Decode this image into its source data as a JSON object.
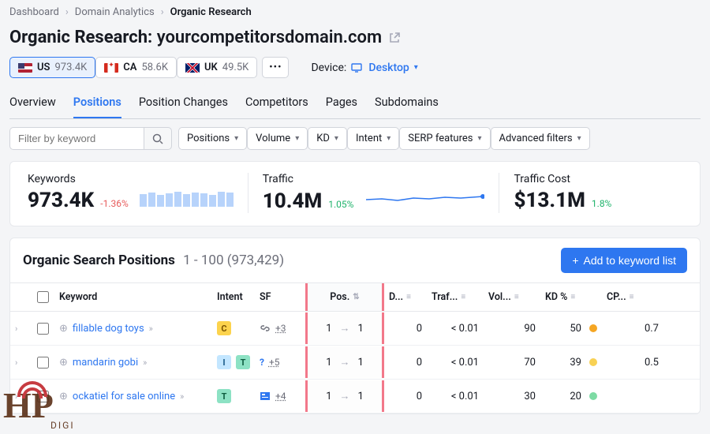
{
  "breadcrumb": {
    "a": "Dashboard",
    "b": "Domain Analytics",
    "c": "Organic Research"
  },
  "title": {
    "prefix": "Organic Research:",
    "domain": "yourcompetitorsdomain.com"
  },
  "countries": [
    {
      "code": "US",
      "val": "973.4K",
      "flag": "flag-us",
      "active": true
    },
    {
      "code": "CA",
      "val": "58.6K",
      "flag": "flag-ca",
      "active": false
    },
    {
      "code": "UK",
      "val": "49.5K",
      "flag": "flag-uk",
      "active": false
    }
  ],
  "device": {
    "label": "Device:",
    "value": "Desktop"
  },
  "tabs": [
    "Overview",
    "Positions",
    "Position Changes",
    "Competitors",
    "Pages",
    "Subdomains"
  ],
  "active_tab": "Positions",
  "filters": {
    "search_placeholder": "Filter by keyword",
    "buttons": [
      "Positions",
      "Volume",
      "KD",
      "Intent",
      "SERP features",
      "Advanced filters"
    ]
  },
  "metrics": {
    "keywords": {
      "label": "Keywords",
      "value": "973.4K",
      "delta": "-1.36%",
      "dir": "down",
      "bars": [
        16,
        18,
        15,
        17,
        19,
        16,
        18,
        17,
        15,
        19,
        18
      ]
    },
    "traffic": {
      "label": "Traffic",
      "value": "10.4M",
      "delta": "1.05%",
      "dir": "up"
    },
    "cost": {
      "label": "Traffic Cost",
      "value": "$13.1M",
      "delta": "1.8%",
      "dir": "up"
    }
  },
  "table": {
    "title": "Organic Search Positions",
    "range": "1 - 100 (973,429)",
    "add_btn": "Add to keyword list",
    "columns": {
      "keyword": "Keyword",
      "intent": "Intent",
      "sf": "SF",
      "pos": "Pos.",
      "d": "D...",
      "traf": "Traf...",
      "vol": "Vol...",
      "kd": "KD %",
      "cp": "CP..."
    },
    "rows": [
      {
        "kw": "fillable dog toys",
        "intent": [
          "C"
        ],
        "sf_icon": "link",
        "sf_count": "+3",
        "pos_from": 1,
        "pos_to": 1,
        "d": 0,
        "traf": "< 0.01",
        "vol": 90,
        "kd": 50,
        "kd_color": "or",
        "cp": "0.7"
      },
      {
        "kw": "mandarin gobi",
        "intent": [
          "I",
          "T"
        ],
        "sf_icon": "question",
        "sf_count": "+5",
        "pos_from": 1,
        "pos_to": 1,
        "d": 0,
        "traf": "< 0.01",
        "vol": 70,
        "kd": 39,
        "kd_color": "ye",
        "cp": "0.5"
      },
      {
        "kw": "ockatiel for sale online",
        "intent": [
          "T"
        ],
        "sf_icon": "card",
        "sf_count": "+4",
        "pos_from": 1,
        "pos_to": 1,
        "d": 0,
        "traf": "< 0.01",
        "vol": 30,
        "kd": 20,
        "kd_color": "gr",
        "cp": ""
      }
    ]
  },
  "watermark": {
    "brand": "HP",
    "sub": "DIGI"
  }
}
